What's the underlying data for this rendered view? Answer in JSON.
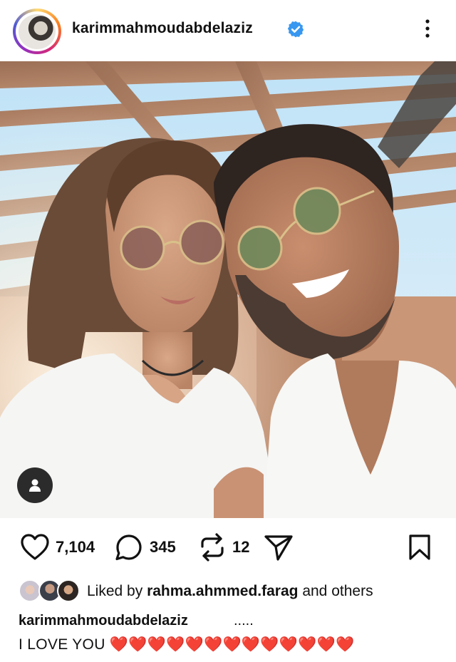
{
  "post": {
    "username": "karimmahmoudabdelaziz",
    "verified": true,
    "more_icon": "more-vertical-icon"
  },
  "photo": {
    "alt_icon": "photo",
    "user_tag_icon": "user-tag-icon"
  },
  "actions": {
    "likes": "7,104",
    "comments": "345",
    "reposts": "12",
    "icons": [
      "heart-icon",
      "comment-icon",
      "repost-icon",
      "share-icon",
      "bookmark-icon"
    ]
  },
  "liked_by": {
    "prefix": "Liked by",
    "user": "rahma.ahmmed.farag",
    "suffix": "and others"
  },
  "caption": {
    "username": "karimmahmoudabdelaziz",
    "dots": ".....",
    "text": "I LOVE YOU ❤️❤️❤️❤️❤️❤️❤️❤️❤️❤️❤️❤️❤️"
  },
  "colors": {
    "verified_blue": "#3897f0",
    "heart_red": "#e0245e"
  }
}
